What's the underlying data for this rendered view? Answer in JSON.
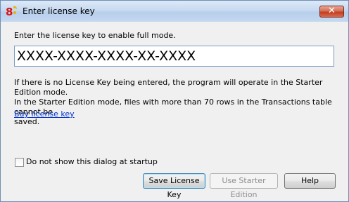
{
  "window": {
    "title": "Enter license key",
    "app_icon": "banana-accounting-icon"
  },
  "close_symbol": "✕",
  "prompt": "Enter the license key to enable full mode.",
  "license_field": {
    "value": "XXXX-XXXX-XXXX-XX-XXXX"
  },
  "info": {
    "line1": "If there is no License Key being entered, the program will operate in the Starter Edition mode.",
    "line2": "In the Starter Edition mode, files with more than 70 rows in the Transactions table cannot be",
    "line3": "saved."
  },
  "buy_link": "Buy license key",
  "startup_checkbox": {
    "label": "Do not show this dialog at startup",
    "checked": false
  },
  "buttons": {
    "save": "Save License Key",
    "starter": "Use Starter Edition",
    "help": "Help"
  },
  "colors": {
    "accent": "#0033cc",
    "close": "#c13e22"
  }
}
